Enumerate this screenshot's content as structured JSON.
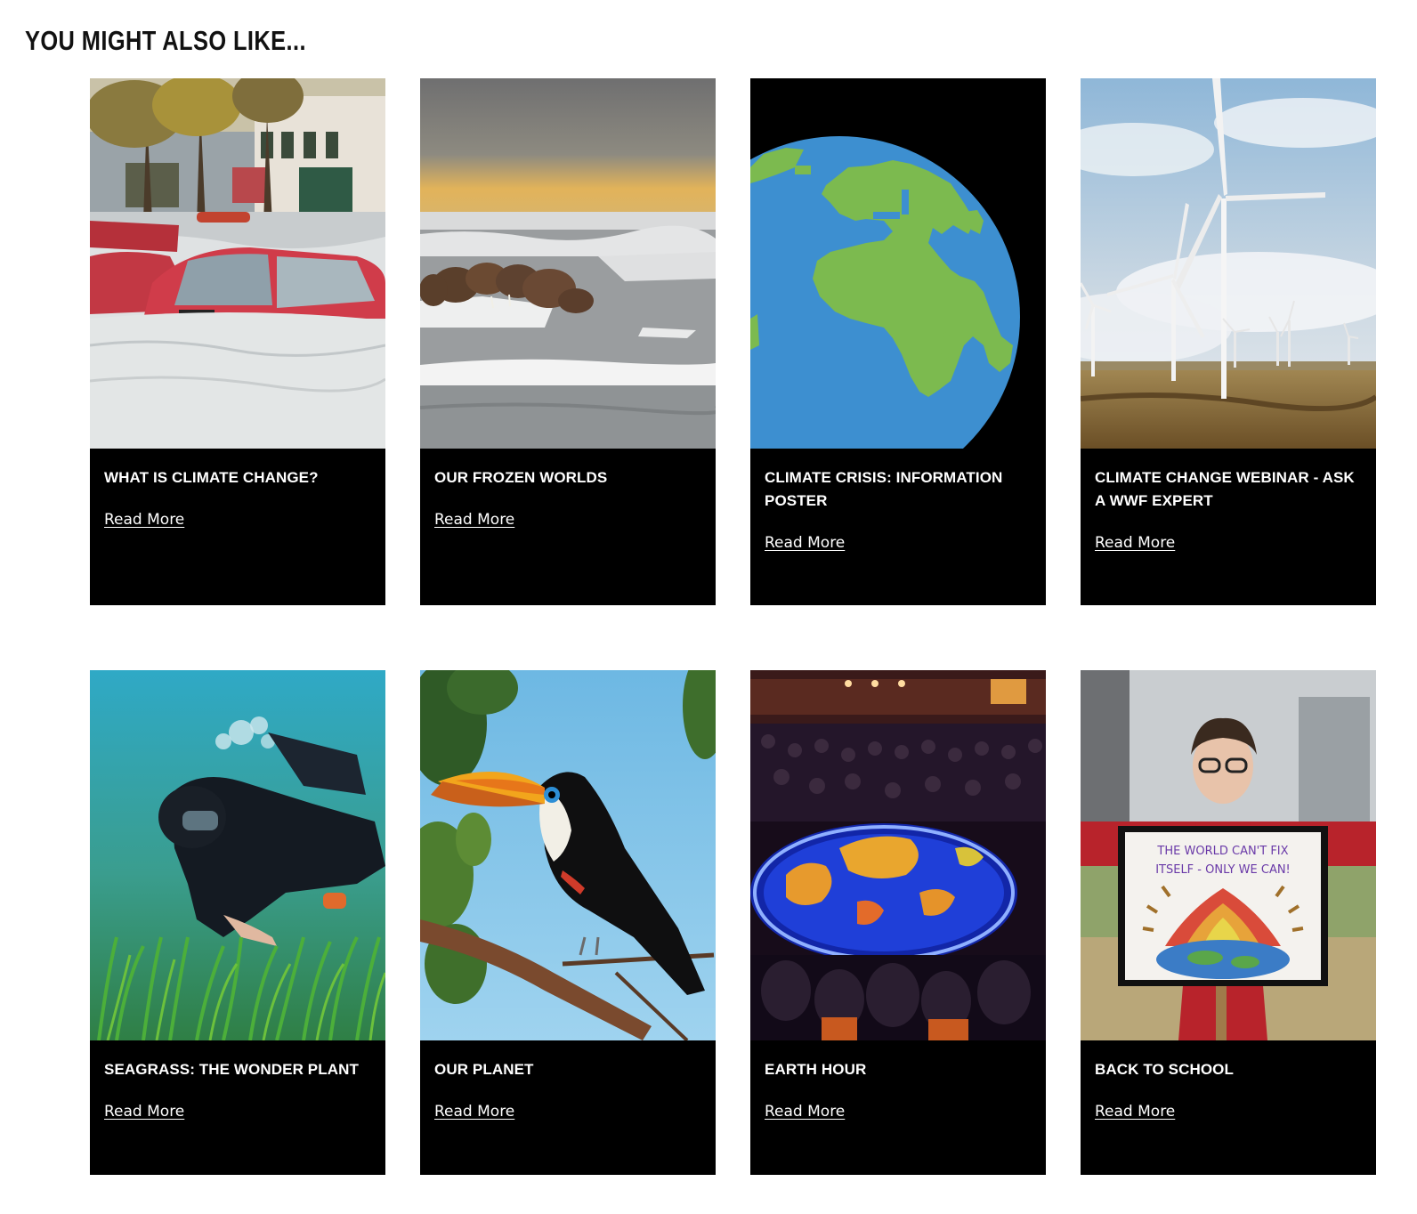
{
  "section": {
    "title": "YOU MIGHT ALSO LIKE..."
  },
  "cards": [
    {
      "title": "WHAT IS CLIMATE CHANGE?",
      "link": "Read More",
      "image": "flooded-street-cars-photo"
    },
    {
      "title": "OUR FROZEN WORLDS",
      "link": "Read More",
      "image": "walruses-on-sea-ice-photo"
    },
    {
      "title": "CLIMATE CRISIS: INFORMATION POSTER",
      "link": "Read More",
      "image": "earth-globe-illustration"
    },
    {
      "title": "CLIMATE CHANGE WEBINAR - ASK A WWF EXPERT",
      "link": "Read More",
      "image": "wind-turbines-photo"
    },
    {
      "title": "SEAGRASS: THE WONDER PLANT",
      "link": "Read More",
      "image": "diver-over-seagrass-photo"
    },
    {
      "title": "OUR PLANET",
      "link": "Read More",
      "image": "toucan-on-branch-photo"
    },
    {
      "title": "EARTH HOUR",
      "link": "Read More",
      "image": "candle-earth-crowd-photo"
    },
    {
      "title": "BACK TO SCHOOL",
      "link": "Read More",
      "image": "child-with-protest-sign-photo"
    }
  ],
  "images_text": {
    "protest_sign_line1": "THE WORLD CAN'T FIX",
    "protest_sign_line2": "ITSELF - ONLY WE CAN!"
  }
}
